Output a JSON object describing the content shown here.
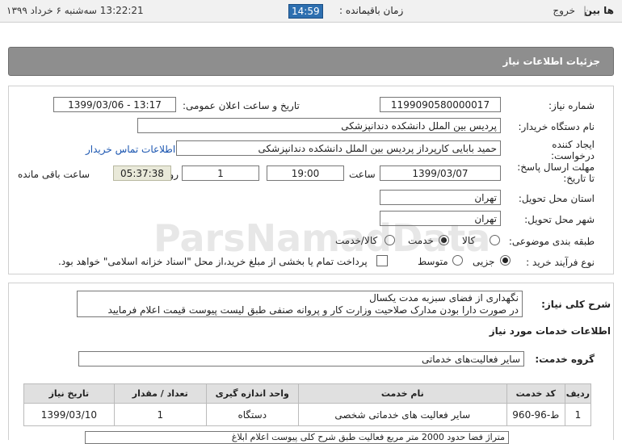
{
  "topbar": {
    "brand": "ها بین",
    "exit": "خروج",
    "remaining_label": "زمان باقیمانده :",
    "timer": "14:59",
    "datetime": "13:22:21  سه‌شنبه ۶ خرداد ۱۳۹۹"
  },
  "header": {
    "title": "جزئیات اطلاعات نیاز"
  },
  "need": {
    "number_label": "شماره نیاز:",
    "number": "1199090580000017",
    "announce_label": "تاریخ و ساعت اعلان عمومی:",
    "announce": "1399/03/06 - 13:17",
    "buyer_label": "نام دستگاه خریدار:",
    "buyer": "پردیس بین الملل دانشکده دندانپزشکی",
    "creator_label": "ایجاد کننده درخواست:",
    "creator": "حمید بابایی کارپرداز پردیس بین الملل دانشکده دندانپزشکی",
    "contact_link": "اطلاعات تماس خریدار",
    "deadline_label": "مهلت ارسال پاسخ: تا تاریخ:",
    "deadline_date": "1399/03/07",
    "time_label": "ساعت",
    "deadline_time": "19:00",
    "days": "1",
    "days_label": "روز و",
    "remaining_time": "05:37:38",
    "remaining_label": "ساعت باقی مانده",
    "province_label": "استان محل تحویل:",
    "province": "تهران",
    "city_label": "شهر محل تحویل:",
    "city": "تهران",
    "category_label": "طبقه بندی موضوعی:",
    "category_options": [
      "کالا",
      "خدمت",
      "کالا/خدمت"
    ],
    "category_selected": "خدمت",
    "process_label": "نوع فرآیند خرید :",
    "process_options": [
      "جزیی",
      "متوسط"
    ],
    "process_selected": "جزیی",
    "treasury_note": "پرداخت تمام یا بخشی از مبلغ خرید،از محل \"اسناد خزانه اسلامی\" خواهد بود."
  },
  "general": {
    "desc_label": "شرح کلی نیاز:",
    "desc_line1": "نگهداری از فضای سبزبه مدت یکسال",
    "desc_line2": "در صورت دارا بودن مدارک صلاحیت وزارت کار و پروانه صنفی طبق لیست پیوست قیمت اعلام فرمایید",
    "services_title": "اطلاعات خدمات مورد نیاز",
    "group_label": "گروه خدمت:",
    "group_value": "سایر فعالیت‌های خدماتی"
  },
  "table": {
    "headers": [
      "ردیف",
      "کد خدمت",
      "نام خدمت",
      "واحد اندازه گیری",
      "تعداد / مقدار",
      "تاریخ نیاز"
    ],
    "rows": [
      [
        "1",
        "ط-96-960",
        "سایر فعالیت های خدماتی شخصی",
        "دستگاه",
        "1",
        "1399/03/10"
      ]
    ]
  },
  "bottom_text": "متراژ فضا حدود 2000 متر مربع فعالیت طبق شرح کلی پیوست اعلام ابلاغ",
  "watermark": "ParsNamadData",
  "colors": {
    "header_bg": "#8e8e8e",
    "timer_bg": "#2d6fb0",
    "link": "#1a55b0"
  }
}
